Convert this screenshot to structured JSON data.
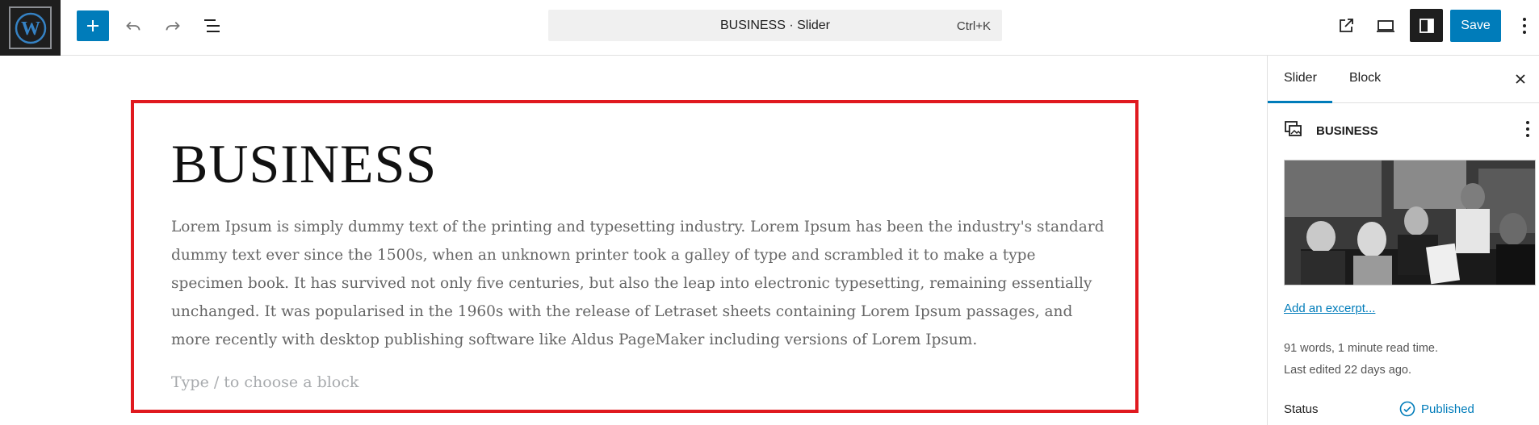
{
  "header": {
    "logo_icon": "wordpress-logo-icon",
    "add_icon": "plus-icon",
    "undo_icon": "undo-icon",
    "redo_icon": "redo-icon",
    "outline_icon": "list-view-icon",
    "command_title": "BUSINESS · Slider",
    "command_shortcut": "Ctrl+K",
    "view_icon": "external-view-icon",
    "device_icon": "desktop-preview-icon",
    "settings_icon": "sidebar-toggle-icon",
    "save_label": "Save",
    "options_icon": "more-vertical-icon"
  },
  "canvas": {
    "title": "BUSINESS",
    "paragraph": "Lorem Ipsum is simply dummy text of the printing and typesetting industry. Lorem Ipsum has been the industry's standard dummy text ever since the 1500s, when an unknown printer took a galley of type and scrambled it to make a type specimen book. It has survived not only five centuries, but also the leap into electronic typesetting, remaining essentially unchanged. It was popularised in the 1960s with the release of Letraset sheets containing Lorem Ipsum passages, and more recently with desktop publishing software like Aldus PageMaker including versions of Lorem Ipsum.",
    "block_placeholder": "Type / to choose a block",
    "selection_color": "#e0191f"
  },
  "sidebar": {
    "tabs": [
      {
        "label": "Slider",
        "active": true
      },
      {
        "label": "Block",
        "active": false
      }
    ],
    "post_type_icon": "slider-post-icon",
    "post_title": "BUSINESS",
    "featured_image_icon": "business-meeting-photo",
    "excerpt_link": "Add an excerpt...",
    "word_count": "91 words, 1 minute read time.",
    "last_edited": "Last edited 22 days ago.",
    "status_label": "Status",
    "status_value": "Published",
    "status_icon": "published-check-icon"
  },
  "colors": {
    "accent": "#007cba",
    "dark": "#1e1e1e"
  }
}
